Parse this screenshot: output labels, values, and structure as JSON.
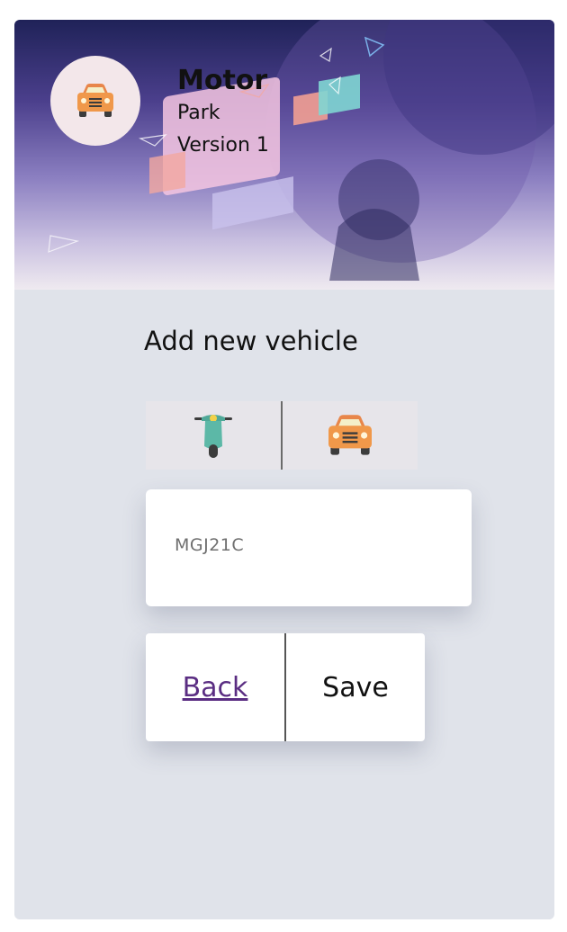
{
  "header": {
    "app_title": "Motor",
    "subtitle": "Park",
    "version": "Version 1",
    "avatar_icon": "car-icon"
  },
  "form": {
    "heading": "Add new vehicle",
    "vehicle_types": [
      {
        "icon": "scooter-icon",
        "selected": false
      },
      {
        "icon": "car-icon",
        "selected": true
      }
    ],
    "plate_input": {
      "value": "MGJ21C",
      "placeholder": ""
    },
    "back_label": "Back",
    "save_label": "Save"
  },
  "colors": {
    "card_bg": "#e0e3ea",
    "link": "#5a2d82",
    "car_body": "#f0984a",
    "scooter_body": "#5cb8a7"
  }
}
